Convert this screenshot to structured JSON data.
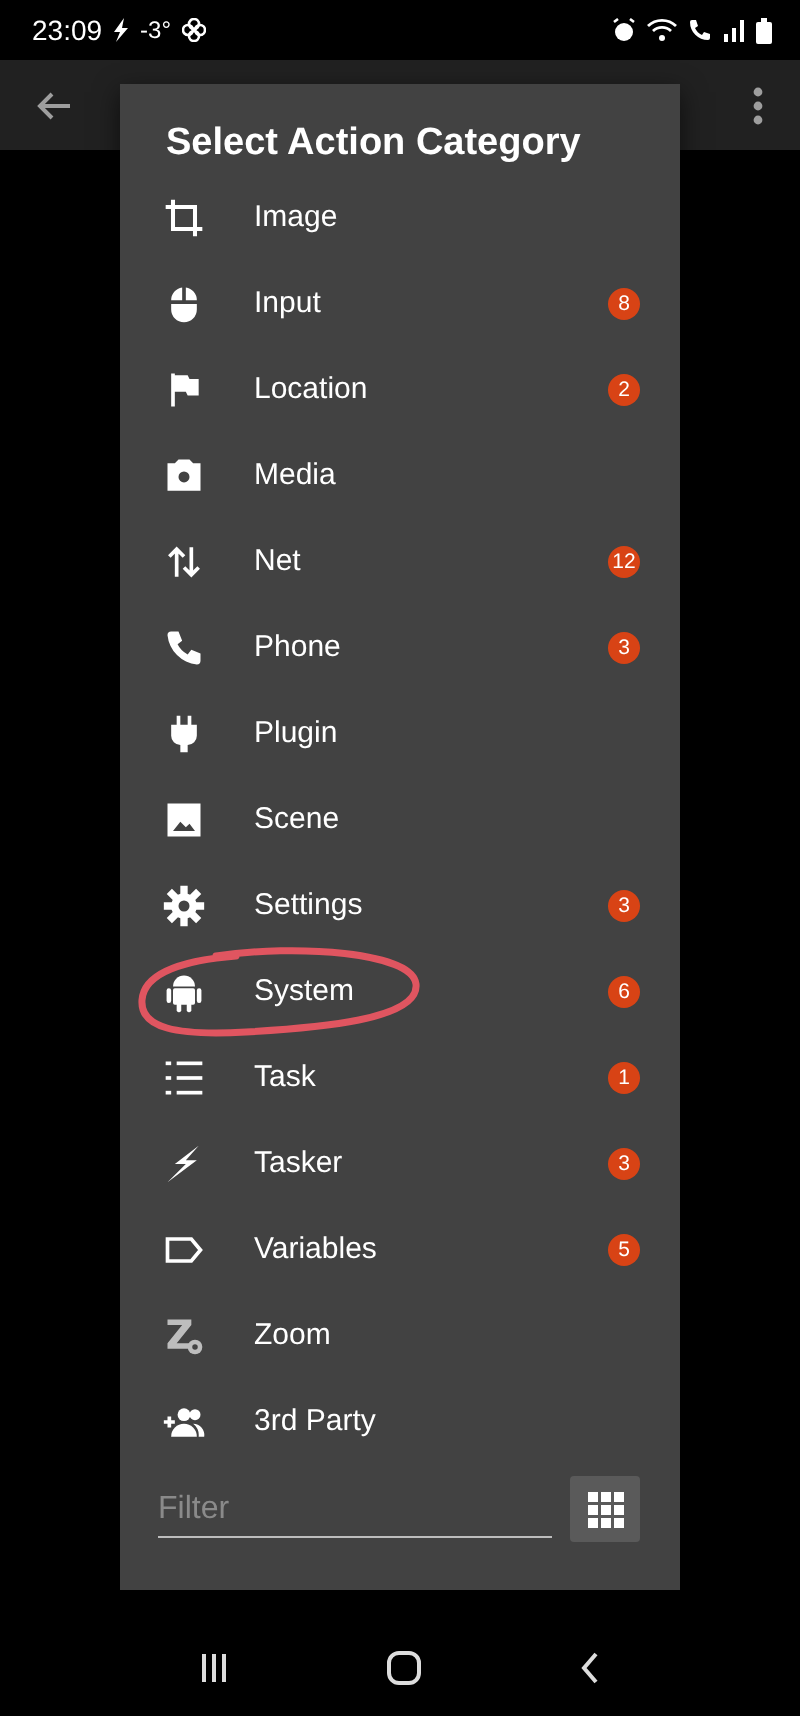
{
  "status_bar": {
    "time": "23:09",
    "temperature": "-3°"
  },
  "dialog": {
    "title": "Select Action Category",
    "items": [
      {
        "label": "Image",
        "annotated": false
      },
      {
        "label": "Input",
        "badge": "8",
        "annotated": false
      },
      {
        "label": "Location",
        "badge": "2",
        "annotated": false
      },
      {
        "label": "Media",
        "annotated": false
      },
      {
        "label": "Net",
        "badge": "12",
        "annotated": false
      },
      {
        "label": "Phone",
        "badge": "3",
        "annotated": false
      },
      {
        "label": "Plugin",
        "annotated": false
      },
      {
        "label": "Scene",
        "annotated": false
      },
      {
        "label": "Settings",
        "badge": "3",
        "annotated": false
      },
      {
        "label": "System",
        "badge": "6",
        "annotated": true
      },
      {
        "label": "Task",
        "badge": "1",
        "annotated": false
      },
      {
        "label": "Tasker",
        "badge": "3",
        "annotated": false
      },
      {
        "label": "Variables",
        "badge": "5",
        "annotated": false
      },
      {
        "label": "Zoom",
        "annotated": false
      },
      {
        "label": "3rd Party",
        "annotated": false
      }
    ],
    "filter": {
      "placeholder": "Filter"
    }
  }
}
